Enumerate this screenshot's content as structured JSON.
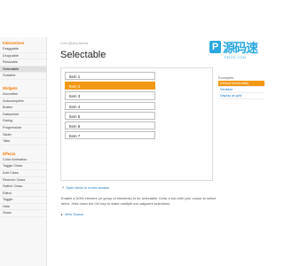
{
  "sidebar": {
    "sections": [
      {
        "heading": "Interactions",
        "items": [
          {
            "label": "Draggable",
            "active": false
          },
          {
            "label": "Droppable",
            "active": false
          },
          {
            "label": "Resizable",
            "active": false
          },
          {
            "label": "Selectable",
            "active": true
          },
          {
            "label": "Sortable",
            "active": false
          }
        ]
      },
      {
        "heading": "Widgets",
        "items": [
          {
            "label": "Accordion",
            "active": false
          },
          {
            "label": "Autocomplete",
            "active": false
          },
          {
            "label": "Button",
            "active": false
          },
          {
            "label": "Datepicker",
            "active": false
          },
          {
            "label": "Dialog",
            "active": false
          },
          {
            "label": "Progressbar",
            "active": false
          },
          {
            "label": "Slider",
            "active": false
          },
          {
            "label": "Tabs",
            "active": false
          }
        ]
      },
      {
        "heading": "Effects",
        "items": [
          {
            "label": "Color Animation",
            "active": false
          },
          {
            "label": "Toggle Class",
            "active": false
          },
          {
            "label": "Add Class",
            "active": false
          },
          {
            "label": "Remove Class",
            "active": false
          },
          {
            "label": "Switch Class",
            "active": false
          },
          {
            "label": "Effect",
            "active": false
          },
          {
            "label": "Toggle",
            "active": false
          },
          {
            "label": "Hide",
            "active": false
          },
          {
            "label": "Show",
            "active": false
          }
        ]
      }
    ]
  },
  "main": {
    "breadcrumb": "Core jQuery demos",
    "title": "Selectable",
    "items": [
      {
        "label": "Item 1",
        "selected": false
      },
      {
        "label": "Item 2",
        "selected": true
      },
      {
        "label": "Item 3",
        "selected": false
      },
      {
        "label": "Item 4",
        "selected": false
      },
      {
        "label": "Item 5",
        "selected": false
      },
      {
        "label": "Item 6",
        "selected": false
      },
      {
        "label": "Item 7",
        "selected": false
      }
    ],
    "open_link": "Open demo in a new window",
    "description": "Enable a DOM element (or group of elements) to be selectable. Draw a box with your cursor to select items. Hold down the Ctrl key to make multiple non-adjacent selections.",
    "view_source": "View Source"
  },
  "logo": {
    "mark": "P",
    "text": "源码速",
    "url": "FMYO.COM"
  },
  "examples": {
    "heading": "Examples",
    "items": [
      {
        "label": "Default functionality",
        "active": true
      },
      {
        "label": "Serialize",
        "active": false
      },
      {
        "label": "Display as grid",
        "active": false
      }
    ]
  },
  "colors": {
    "accent": "#f39814",
    "link": "#1a78c2",
    "logo": "#29a9e0",
    "heading": "#f57c00"
  }
}
